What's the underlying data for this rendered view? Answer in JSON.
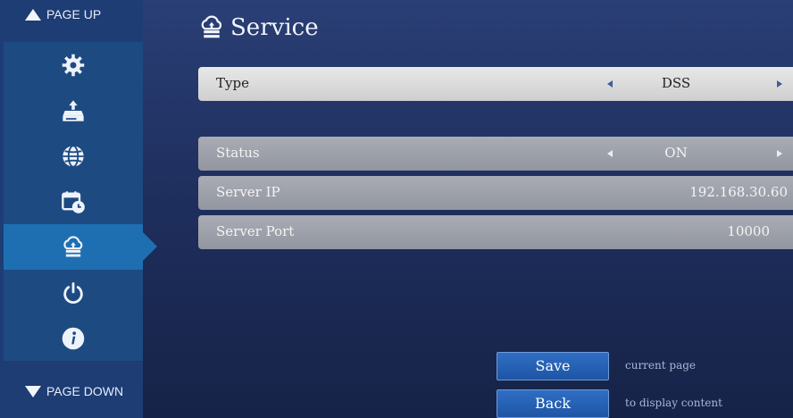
{
  "header": {
    "title": "Service",
    "title_icon": "cloud-service-icon"
  },
  "sidebar": {
    "page_up": "PAGE UP",
    "page_down": "PAGE DOWN",
    "items": [
      {
        "icon": "gear-icon"
      },
      {
        "icon": "network-drive-icon"
      },
      {
        "icon": "globe-icon"
      },
      {
        "icon": "calendar-clock-icon"
      },
      {
        "icon": "cloud-service-icon",
        "active": true
      },
      {
        "icon": "power-icon"
      },
      {
        "icon": "info-icon"
      }
    ]
  },
  "settings": {
    "type": {
      "label": "Type",
      "value": "DSS"
    },
    "status": {
      "label": "Status",
      "value": "ON"
    },
    "server_ip": {
      "label": "Server IP",
      "value": "192.168.30.60"
    },
    "server_port": {
      "label": "Server Port",
      "value": "10000"
    }
  },
  "actions": {
    "save": {
      "label": "Save",
      "hint": "current page"
    },
    "back": {
      "label": "Back",
      "hint": "to display content"
    }
  },
  "colors": {
    "accent": "#1e6fb2",
    "sidebar": "#1e4a82",
    "background": "#22366b",
    "button": "#2a64b8"
  }
}
